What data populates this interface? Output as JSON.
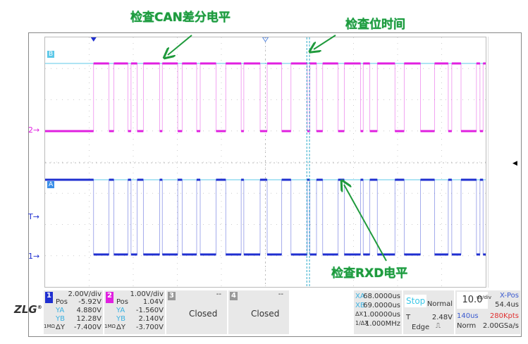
{
  "annotations": {
    "can_level": "检查CAN差分电平",
    "bit_time": "检查位时间",
    "rxd_level": "检查RXD电平"
  },
  "markers": {
    "cursor_b": "B",
    "cursor_a": "A",
    "ch2": "2",
    "trigger": "T",
    "ch1": "1"
  },
  "colors": {
    "ch1": "#1f2fd0",
    "ch2": "#e020e0",
    "cursor": "#5cc8e8",
    "note": "#1f9a3c"
  },
  "waveform": {
    "time_per_div_us": 10,
    "divisions": 10,
    "start_us": 11.0,
    "pulses_us": [
      [
        14.5,
        15.6
      ],
      [
        18.8,
        19.5
      ],
      [
        20.9,
        22.3
      ],
      [
        26.0,
        26.6
      ],
      [
        30.1,
        31.1
      ],
      [
        34.4,
        35.2
      ],
      [
        38.8,
        41.0
      ],
      [
        44.5,
        45.1
      ],
      [
        48.8,
        50.4
      ],
      [
        53.7,
        55.8
      ],
      [
        59.5,
        60.1
      ],
      [
        61.6,
        63.0
      ],
      [
        66.5,
        67.9
      ],
      [
        71.6,
        72.2
      ],
      [
        73.7,
        75.4
      ],
      [
        79.4,
        81.5
      ],
      [
        85.2,
        88.4
      ],
      [
        91.5,
        92.3
      ],
      [
        94.4,
        97.9
      ],
      [
        98.7,
        99.4
      ]
    ],
    "cursor_xa_us": 59.4,
    "cursor_xb_us": 60.0
  },
  "logo": "ZLG",
  "ch1": {
    "num": "1",
    "scale": "2.00V/div",
    "pos_label": "Pos",
    "pos": "-5.92V",
    "ya_label": "YA",
    "ya": "4.880V",
    "yb_label": "YB",
    "yb": "12.28V",
    "dy_label": "ΔY",
    "dy": "-7.400V",
    "coupling": "1MΩ"
  },
  "ch2": {
    "num": "2",
    "scale": "1.00V/div",
    "pos_label": "Pos",
    "pos": "1.04V",
    "ya_label": "YA",
    "ya": "-1.560V",
    "yb_label": "YB",
    "yb": "2.140V",
    "dy_label": "ΔY",
    "dy": "-3.700V",
    "coupling": "1MΩ"
  },
  "ch3": {
    "num": "3",
    "status": "Closed",
    "dash": "--"
  },
  "ch4": {
    "num": "4",
    "status": "Closed",
    "dash": "--"
  },
  "cursors": {
    "xa_label": "XA",
    "xa": "68.0000us",
    "xb_label": "XB",
    "xb": "69.0000us",
    "dx_label": "ΔX",
    "dx": "1.00000us",
    "fx_label": "1/ΔX",
    "fx": "1.000MHz"
  },
  "trigger": {
    "state": "Stop",
    "mode": "Normal",
    "t_label": "T",
    "level": "2.48V",
    "type": "Edge"
  },
  "timebase": {
    "scale": "10.0",
    "unit": "us/div",
    "xpos_label": "X-Pos",
    "xpos": "54.4us",
    "window": "140us",
    "points": "280Kpts",
    "acq": "Norm",
    "rate": "2.00GSa/s"
  }
}
